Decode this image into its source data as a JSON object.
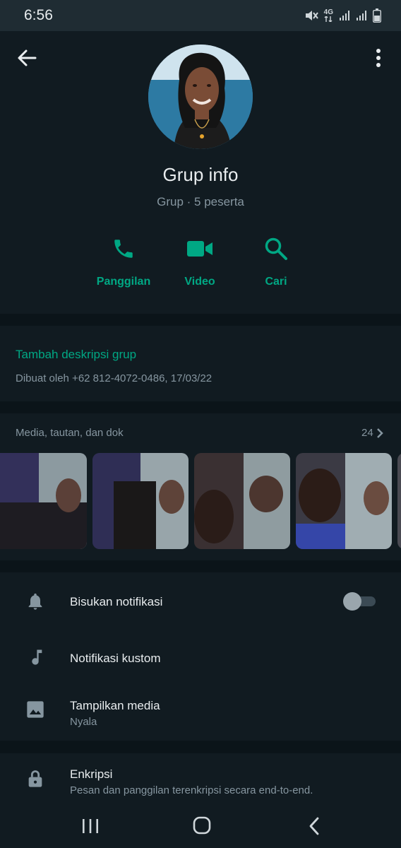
{
  "status_bar": {
    "time": "6:56",
    "network": "4G",
    "icons": [
      "mute-icon",
      "network-4g-icon",
      "signal-icon",
      "signal-icon",
      "battery-icon"
    ]
  },
  "header": {
    "title": "Grup info",
    "subtitle": "Grup · 5 peserta",
    "actions": [
      {
        "label": "Panggilan",
        "icon": "phone-icon"
      },
      {
        "label": "Video",
        "icon": "video-icon"
      },
      {
        "label": "Cari",
        "icon": "search-icon"
      }
    ]
  },
  "description": {
    "add_link": "Tambah deskripsi grup",
    "created_by": "Dibuat oleh +62 812-4072-0486, 17/03/22"
  },
  "media": {
    "label": "Media, tautan, dan dok",
    "count": "24"
  },
  "settings": {
    "mute": {
      "title": "Bisukan notifikasi",
      "enabled": false
    },
    "custom": {
      "title": "Notifikasi kustom"
    },
    "media_visibility": {
      "title": "Tampilkan media",
      "value": "Nyala"
    },
    "encryption": {
      "title": "Enkripsi",
      "subtitle": "Pesan dan panggilan terenkripsi secara end-to-end."
    }
  },
  "colors": {
    "accent": "#00a884",
    "background": "#0b1419",
    "surface": "#111b21",
    "text_secondary": "#8696a0"
  }
}
